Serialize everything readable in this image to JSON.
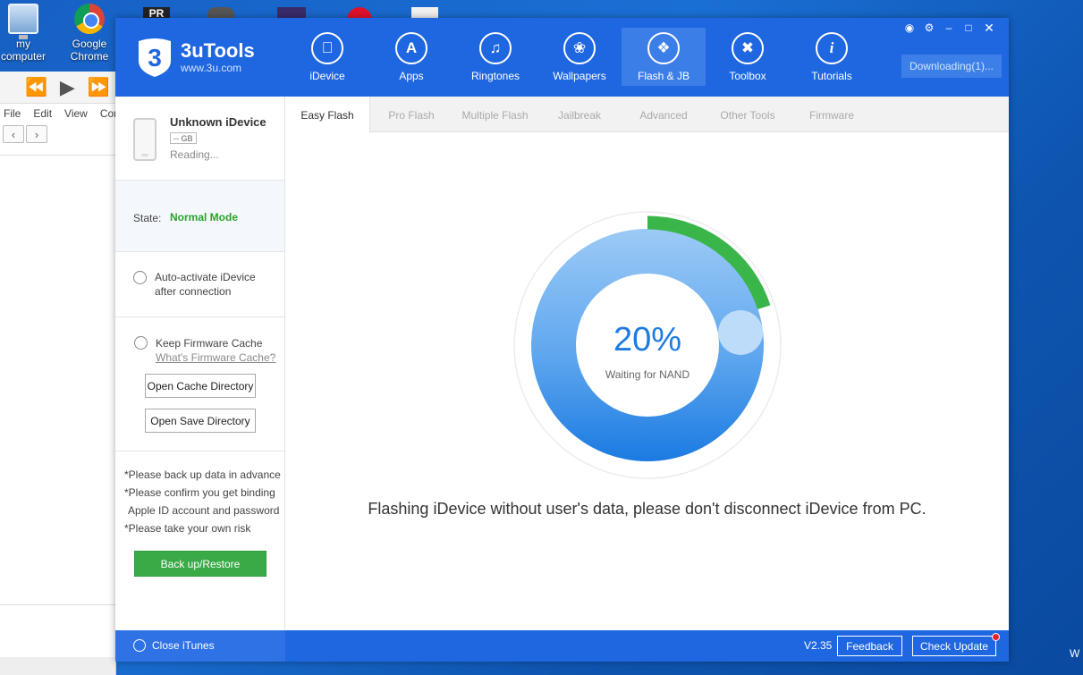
{
  "desktop": {
    "icons": [
      {
        "label_line1": "my",
        "label_line2": "computer"
      },
      {
        "label_line1": "Google",
        "label_line2": "Chrome"
      }
    ],
    "partial_icon_text": "PR",
    "right_edge_text": "W"
  },
  "background_window": {
    "menu": [
      "File",
      "Edit",
      "View",
      "Cont"
    ]
  },
  "app": {
    "name": "3uTools",
    "url": "www.3u.com",
    "nav": [
      {
        "label": "iDevice",
        "icon": "apple-icon"
      },
      {
        "label": "Apps",
        "icon": "app-store-icon"
      },
      {
        "label": "Ringtones",
        "icon": "bell-icon"
      },
      {
        "label": "Wallpapers",
        "icon": "flower-icon"
      },
      {
        "label": "Flash & JB",
        "icon": "dropbox-icon"
      },
      {
        "label": "Toolbox",
        "icon": "tools-icon"
      },
      {
        "label": "Tutorials",
        "icon": "info-icon"
      }
    ],
    "active_nav": "Flash & JB",
    "downloading_label": "Downloading(1)...",
    "colors": {
      "header": "#1f67e0",
      "accent_green": "#3aaa47",
      "progress_green": "#3ab54a",
      "progress_blue": "#1f7ae0"
    }
  },
  "sidebar": {
    "device_name": "Unknown iDevice",
    "capacity": "-- GB",
    "device_status": "Reading...",
    "state_label": "State:",
    "state_value": "Normal Mode",
    "auto_activate_line1": "Auto-activate iDevice",
    "auto_activate_line2": "after connection",
    "keep_cache_label": "Keep Firmware Cache",
    "cache_link": "What's Firmware Cache?",
    "open_cache_button": "Open Cache Directory",
    "open_save_button": "Open Save Directory",
    "notes": [
      "*Please back up data in advance",
      "*Please confirm you get binding",
      "Apple ID account and password",
      "*Please take your own risk"
    ],
    "backup_button": "Back up/Restore"
  },
  "tabs": [
    "Easy Flash",
    "Pro Flash",
    "Multiple Flash",
    "Jailbreak",
    "Advanced",
    "Other Tools",
    "Firmware"
  ],
  "active_tab": "Easy Flash",
  "flash": {
    "percent_label": "20%",
    "progress": 0.2,
    "status": "Waiting for NAND",
    "message": "Flashing iDevice without user's data, please don't disconnect iDevice from PC."
  },
  "footer": {
    "close_itunes": "Close iTunes",
    "version": "V2.35",
    "feedback_button": "Feedback",
    "check_update_button": "Check Update"
  }
}
